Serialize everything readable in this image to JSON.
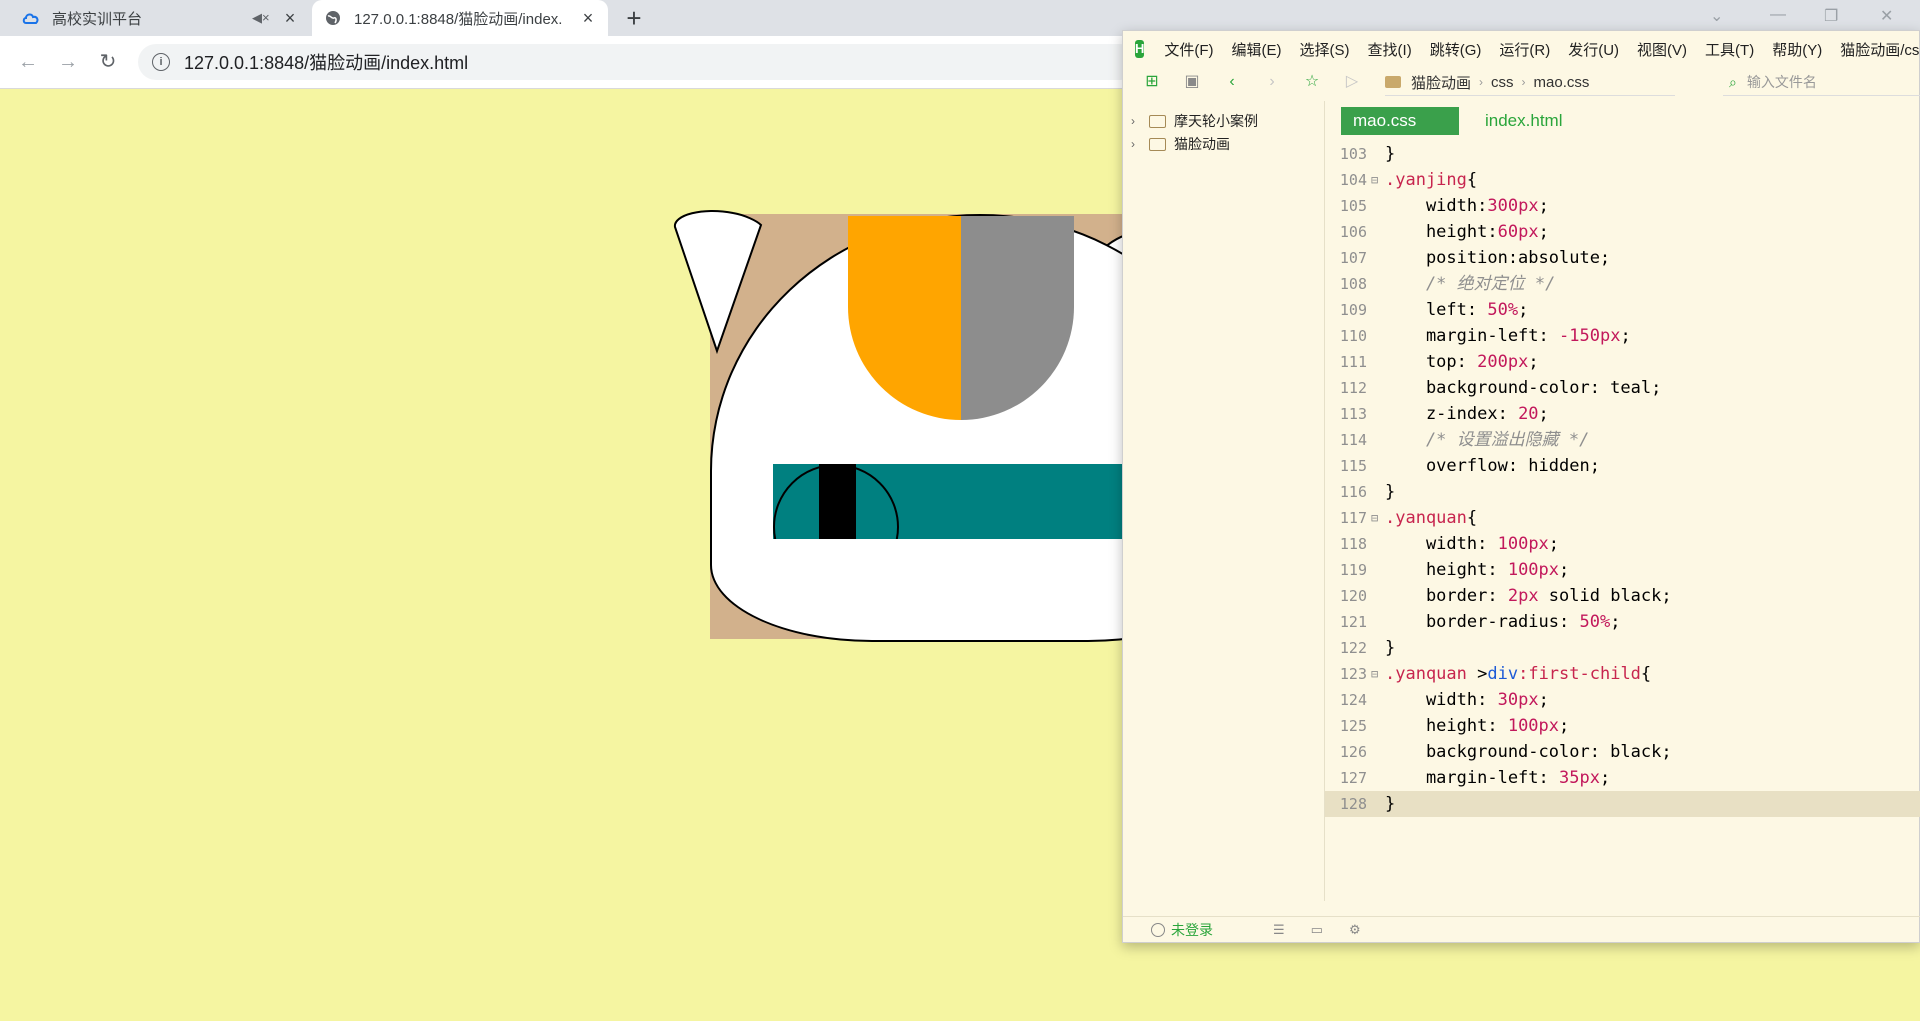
{
  "browser": {
    "tabs": [
      {
        "title": "高校实训平台",
        "favicon": "cloud-icon",
        "muted": true,
        "active": false
      },
      {
        "title": "127.0.0.1:8848/猫脸动画/index.",
        "favicon": "globe-icon",
        "active": true
      }
    ],
    "url": "127.0.0.1:8848/猫脸动画/index.html"
  },
  "page": {
    "colors": {
      "background": "#f5f5a1",
      "box": "#d2b18c",
      "face": "#ffffff",
      "mark_left": "#ffa500",
      "mark_right": "#8d8d8d",
      "yanjing": "#008080",
      "pupil": "#000000"
    }
  },
  "editor": {
    "menu": [
      "文件(F)",
      "编辑(E)",
      "选择(S)",
      "查找(I)",
      "跳转(G)",
      "运行(R)",
      "发行(U)",
      "视图(V)",
      "工具(T)",
      "帮助(Y)",
      "猫脸动画/cs"
    ],
    "breadcrumb": [
      "猫脸动画",
      "css",
      "mao.css"
    ],
    "search_placeholder": "输入文件名",
    "projects": [
      "摩天轮小案例",
      "猫脸动画"
    ],
    "file_tabs": [
      {
        "name": "mao.css",
        "active": true
      },
      {
        "name": "index.html",
        "active": false
      }
    ],
    "code_lines": [
      {
        "n": "103",
        "fold": "",
        "text": "}"
      },
      {
        "n": "104",
        "fold": "⊟",
        "text": ".yanjing{"
      },
      {
        "n": "105",
        "fold": "",
        "text": "    width:300px;"
      },
      {
        "n": "106",
        "fold": "",
        "text": "    height:60px;"
      },
      {
        "n": "107",
        "fold": "",
        "text": "    position:absolute;"
      },
      {
        "n": "108",
        "fold": "",
        "text": "    /* 绝对定位 */"
      },
      {
        "n": "109",
        "fold": "",
        "text": "    left: 50%;"
      },
      {
        "n": "110",
        "fold": "",
        "text": "    margin-left: -150px;"
      },
      {
        "n": "111",
        "fold": "",
        "text": "    top: 200px;"
      },
      {
        "n": "112",
        "fold": "",
        "text": "    background-color: teal;"
      },
      {
        "n": "113",
        "fold": "",
        "text": "    z-index: 20;"
      },
      {
        "n": "114",
        "fold": "",
        "text": "    /* 设置溢出隐藏 */"
      },
      {
        "n": "115",
        "fold": "",
        "text": "    overflow: hidden;"
      },
      {
        "n": "116",
        "fold": "",
        "text": "}"
      },
      {
        "n": "117",
        "fold": "⊟",
        "text": ".yanquan{"
      },
      {
        "n": "118",
        "fold": "",
        "text": "    width: 100px;"
      },
      {
        "n": "119",
        "fold": "",
        "text": "    height: 100px;"
      },
      {
        "n": "120",
        "fold": "",
        "text": "    border: 2px solid black;"
      },
      {
        "n": "121",
        "fold": "",
        "text": "    border-radius: 50%;"
      },
      {
        "n": "122",
        "fold": "",
        "text": "}"
      },
      {
        "n": "123",
        "fold": "⊟",
        "text": ".yanquan >div:first-child{"
      },
      {
        "n": "124",
        "fold": "",
        "text": "    width: 30px;"
      },
      {
        "n": "125",
        "fold": "",
        "text": "    height: 100px;"
      },
      {
        "n": "126",
        "fold": "",
        "text": "    background-color: black;"
      },
      {
        "n": "127",
        "fold": "",
        "text": "    margin-left: 35px;"
      },
      {
        "n": "128",
        "fold": "",
        "text": "}",
        "current": true
      }
    ],
    "status": {
      "login": "未登录"
    }
  }
}
